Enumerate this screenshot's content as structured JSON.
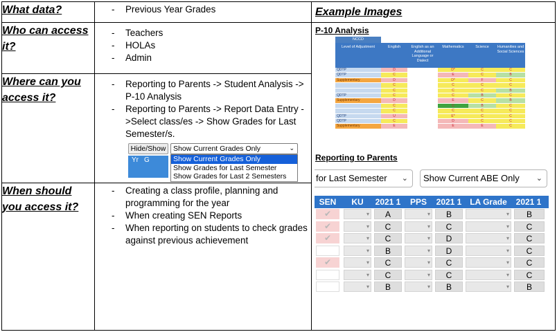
{
  "rows": [
    {
      "question": "What data?",
      "items": [
        "Previous Year Grades"
      ]
    },
    {
      "question": "Who can access it?",
      "items": [
        "Teachers",
        "HOLAs",
        "Admin"
      ]
    },
    {
      "question": "Where can you access it?",
      "items": [
        "Reporting to Parents -> Student Analysis -> P-10 Analysis",
        "Reporting to Parents -> Report Data Entry ->Select class/es -> Show Grades for Last Semester/s."
      ]
    },
    {
      "question": "When should you access it?",
      "items": [
        "Creating a class profile, planning and programming for the year",
        "When creating SEN Reports",
        "When reporting on students to check grades against previous achievement"
      ]
    }
  ],
  "example_header": "Example Images",
  "mini_dropdown": {
    "button": "Hide/Show",
    "selected": "Show Current Grades Only",
    "options": [
      "Show Current Grades Only",
      "Show Grades for Last Semester",
      "Show Grades for Last 2 Semesters"
    ],
    "grid_headers": [
      "Yr",
      "G"
    ]
  },
  "p10": {
    "title": "P-10 Analysis",
    "nccd": "NCCD",
    "headers": [
      "Level of Adjustment",
      "English",
      "English as an Additional Language or Dialect",
      "Mathematics",
      "Science",
      "Humanities and Social Sciences"
    ],
    "rows": [
      {
        "level": "QDTP",
        "cells": [
          "D",
          "",
          "D*",
          "C",
          "C"
        ]
      },
      {
        "level": "QDTP",
        "cells": [
          "C",
          "",
          "E",
          "C",
          "B"
        ]
      },
      {
        "level": "Supplementary",
        "cells": [
          "D",
          "",
          "D*",
          "F",
          "C"
        ]
      },
      {
        "level": "",
        "cells": [
          "C",
          "",
          "C",
          "C",
          "C"
        ]
      },
      {
        "level": "",
        "cells": [
          "C",
          "",
          "C",
          "C",
          "B"
        ]
      },
      {
        "level": "QDTP",
        "cells": [
          "C",
          "",
          "C",
          "B",
          "C"
        ]
      },
      {
        "level": "Supplementary",
        "cells": [
          "D",
          "",
          "E",
          "C",
          "B"
        ]
      },
      {
        "level": "",
        "cells": [
          "C",
          "",
          "C",
          "B",
          "C"
        ]
      },
      {
        "level": "",
        "cells": [
          "C",
          "",
          "C",
          "C",
          "C"
        ]
      },
      {
        "level": "QDTP",
        "cells": [
          "U",
          "",
          "E*",
          "C",
          "C"
        ]
      },
      {
        "level": "QDTP",
        "cells": [
          "C",
          "",
          "D",
          "C",
          "C"
        ]
      },
      {
        "level": "Supplementary",
        "cells": [
          "E",
          "",
          "E",
          "E",
          "C"
        ]
      }
    ]
  },
  "rtp": {
    "title": "Reporting to Parents",
    "dropdown_left": "for Last Semester",
    "dropdown_right": "Show Current ABE Only",
    "headers": [
      "SEN",
      "KU",
      "2021 1",
      "PPS",
      "2021 1",
      "LA Grade",
      "2021 1"
    ],
    "rows": [
      {
        "sen": "✔",
        "g1": "A",
        "g2": "B",
        "g3": "B"
      },
      {
        "sen": "✔",
        "g1": "C",
        "g2": "C",
        "g3": "C"
      },
      {
        "sen": "✔",
        "g1": "C",
        "g2": "D",
        "g3": "C"
      },
      {
        "sen": "",
        "g1": "B",
        "g2": "D",
        "g3": "C"
      },
      {
        "sen": "✔",
        "g1": "C",
        "g2": "C",
        "g3": "C"
      },
      {
        "sen": "",
        "g1": "C",
        "g2": "C",
        "g3": "C"
      },
      {
        "sen": "",
        "g1": "B",
        "g2": "B",
        "g3": "B"
      }
    ]
  },
  "colors": {
    "grade_red": "#f4b8b8",
    "grade_yellow": "#f6ea5a",
    "grade_green": "#b7e0a4",
    "grade_darkgreen": "#3fa33f",
    "header_blue": "#3d78c4"
  }
}
